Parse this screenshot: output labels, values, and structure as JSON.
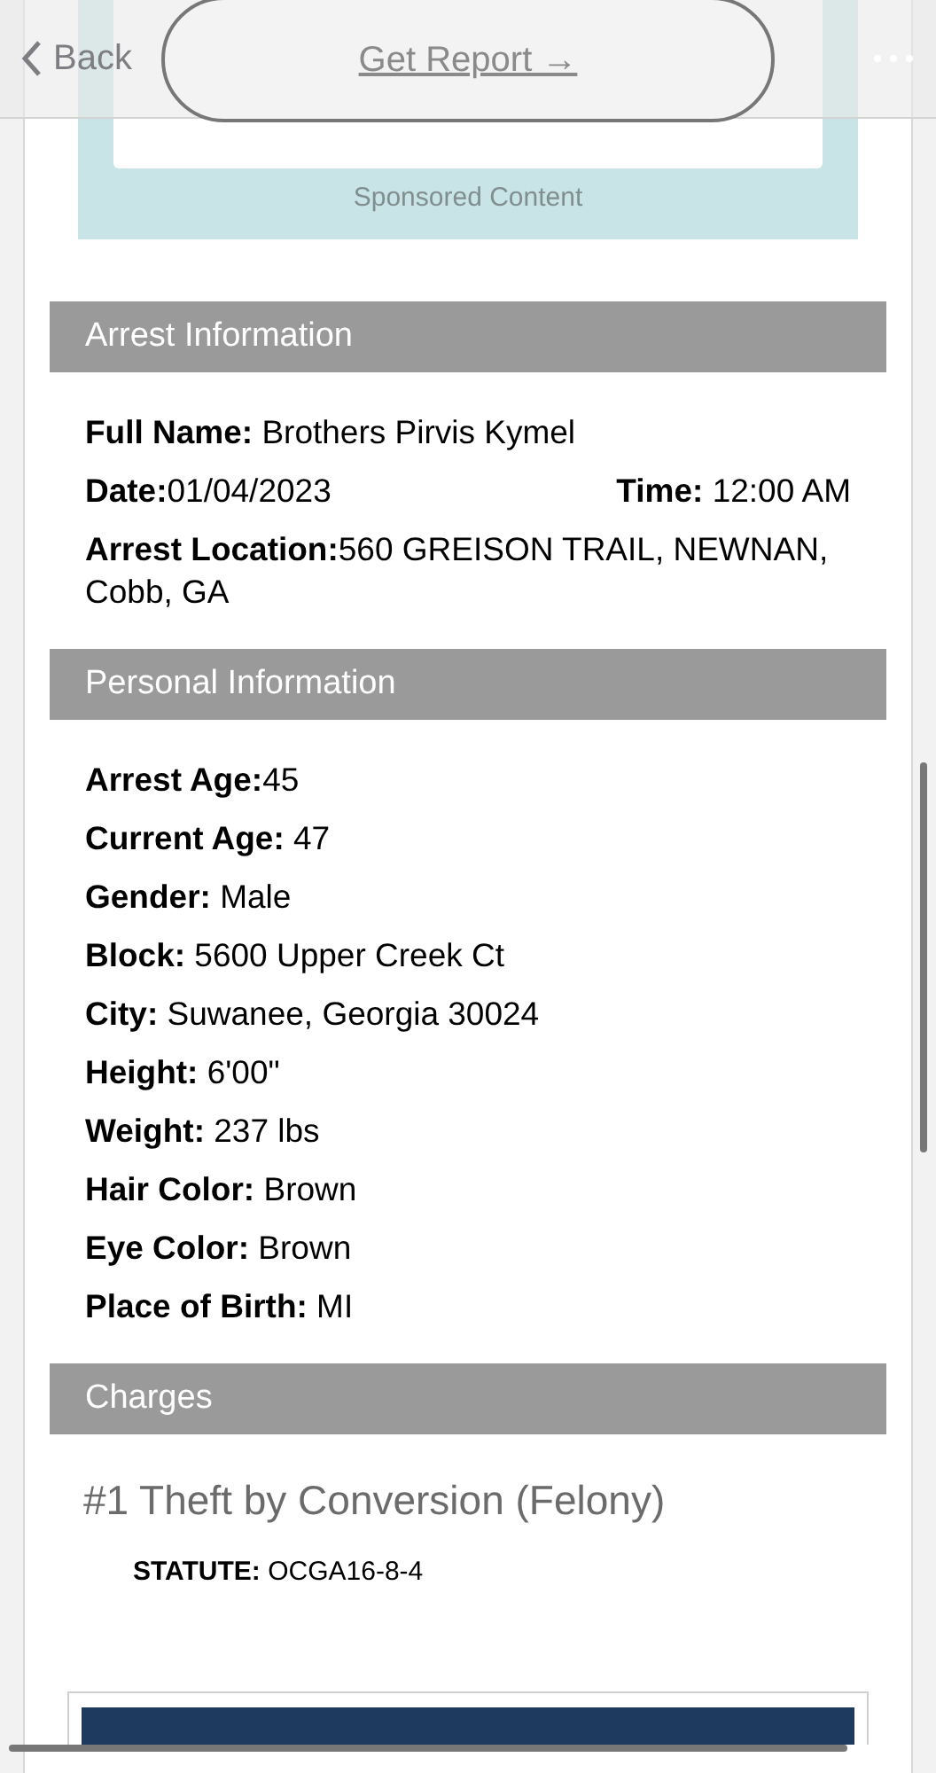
{
  "nav": {
    "back": "Back"
  },
  "ad": {
    "button": "Get Report →",
    "caption": "Sponsored Content"
  },
  "sections": [
    {
      "kind": "fields",
      "title": "Arrest Information",
      "rows": [
        [
          "**Full Name:** Brothers Pirvis Kymel"
        ],
        [
          "**Date:**01/04/2023",
          "**Time:** 12:00 AM"
        ],
        [
          "**Arrest Location:**560 GREISON TRAIL, NEWNAN, Cobb, GA"
        ]
      ]
    },
    {
      "kind": "fields",
      "title": "Personal Information",
      "rows": [
        [
          "**Arrest Age:**45"
        ],
        [
          "**Current Age:** 47"
        ],
        [
          "**Gender:** Male"
        ],
        [
          "**Block:** 5600 Upper Creek Ct"
        ],
        [
          "**City:** Suwanee, Georgia 30024"
        ],
        [
          "**Height:** 6'00\""
        ],
        [
          "**Weight:** 237 lbs"
        ],
        [
          "**Hair Color:** Brown"
        ],
        [
          "**Eye Color:** Brown"
        ],
        [
          "**Place of Birth:** MI"
        ]
      ]
    },
    {
      "kind": "charges",
      "title": "Charges",
      "charges": [
        {
          "title": "#1 Theft by Conversion (Felony)",
          "statute": "**STATUTE:** OCGA16-8-4"
        }
      ]
    }
  ]
}
